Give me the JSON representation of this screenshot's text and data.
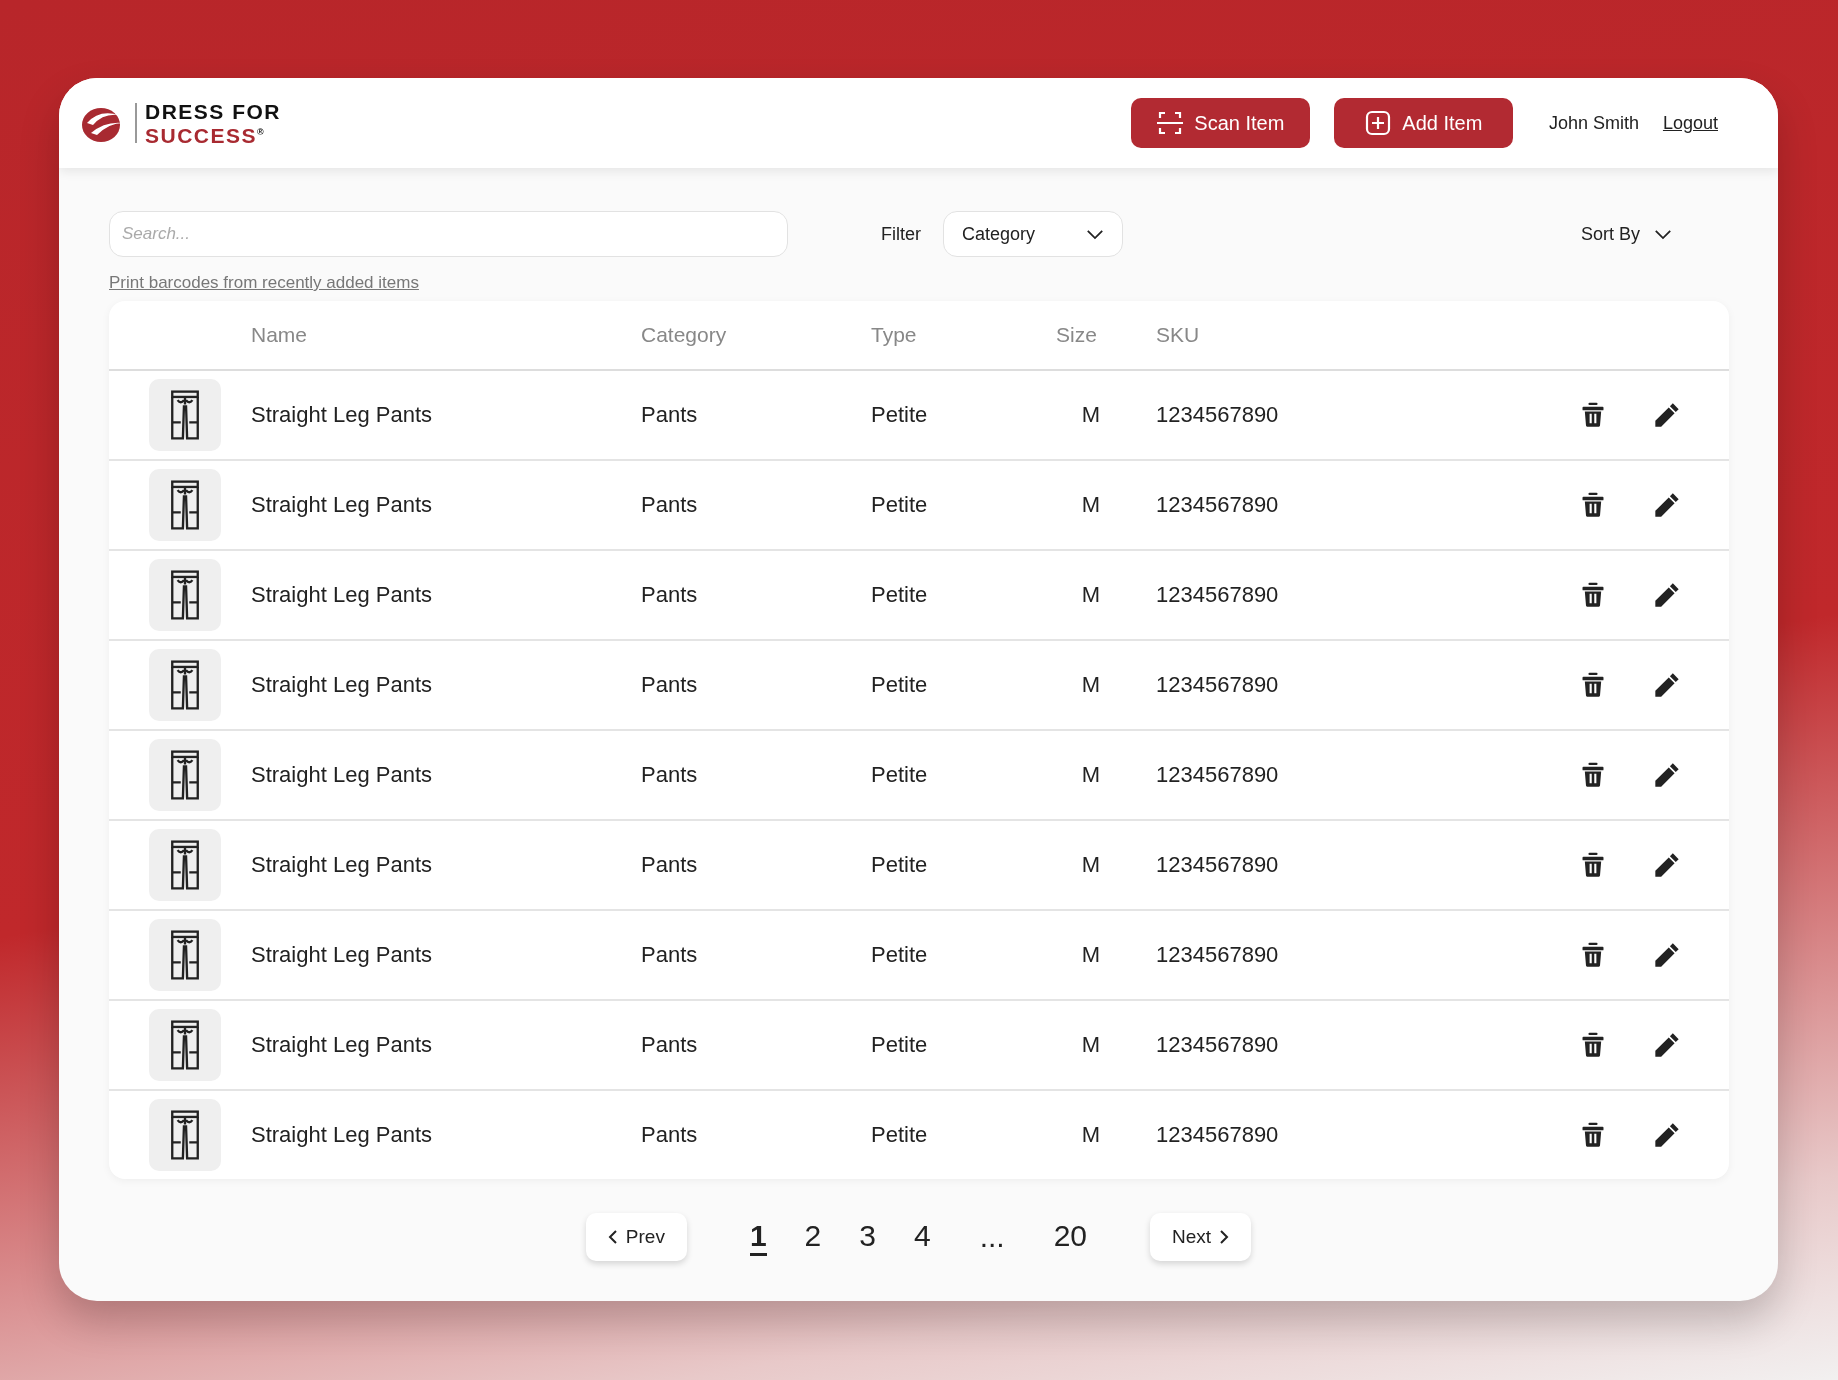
{
  "logo": {
    "line1": "DRESS FOR",
    "line2": "SUCCESS$^{®}$"
  },
  "header": {
    "buttons": [
      {
        "kind": "scan",
        "label": "Scan Item"
      },
      {
        "kind": "add",
        "label": "Add Item"
      }
    ],
    "user": "John Smith",
    "logout": "Logout"
  },
  "toolbar": {
    "search": {
      "placeholder": "Search..."
    },
    "filter_label": "Filter",
    "filter_value": "Category",
    "sort": "Sort By"
  },
  "print_link": "Print barcodes from recently added items",
  "table": {
    "columns": [
      "Name",
      "Category",
      "Type",
      "Size",
      "SKU"
    ],
    "rows": [
      {
        "name": "Straight Leg Pants",
        "category": "Pants",
        "type": "Petite",
        "size": "M",
        "sku": "1234567890"
      },
      {
        "name": "Straight Leg Pants",
        "category": "Pants",
        "type": "Petite",
        "size": "M",
        "sku": "1234567890"
      },
      {
        "name": "Straight Leg Pants",
        "category": "Pants",
        "type": "Petite",
        "size": "M",
        "sku": "1234567890"
      },
      {
        "name": "Straight Leg Pants",
        "category": "Pants",
        "type": "Petite",
        "size": "M",
        "sku": "1234567890"
      },
      {
        "name": "Straight Leg Pants",
        "category": "Pants",
        "type": "Petite",
        "size": "M",
        "sku": "1234567890"
      },
      {
        "name": "Straight Leg Pants",
        "category": "Pants",
        "type": "Petite",
        "size": "M",
        "sku": "1234567890"
      },
      {
        "name": "Straight Leg Pants",
        "category": "Pants",
        "type": "Petite",
        "size": "M",
        "sku": "1234567890"
      },
      {
        "name": "Straight Leg Pants",
        "category": "Pants",
        "type": "Petite",
        "size": "M",
        "sku": "1234567890"
      },
      {
        "name": "Straight Leg Pants",
        "category": "Pants",
        "type": "Petite",
        "size": "M",
        "sku": "1234567890"
      }
    ]
  },
  "pagination": {
    "prev": "Prev",
    "next": "Next",
    "pages": [
      {
        "kind": "page",
        "label": "1",
        "selected": true
      },
      {
        "kind": "page",
        "label": "2",
        "selected": false
      },
      {
        "kind": "page",
        "label": "3",
        "selected": false
      },
      {
        "kind": "page",
        "label": "4",
        "selected": false
      },
      {
        "kind": "ellipsis",
        "label": "..."
      },
      {
        "kind": "page",
        "label": "20",
        "selected": false
      }
    ]
  }
}
